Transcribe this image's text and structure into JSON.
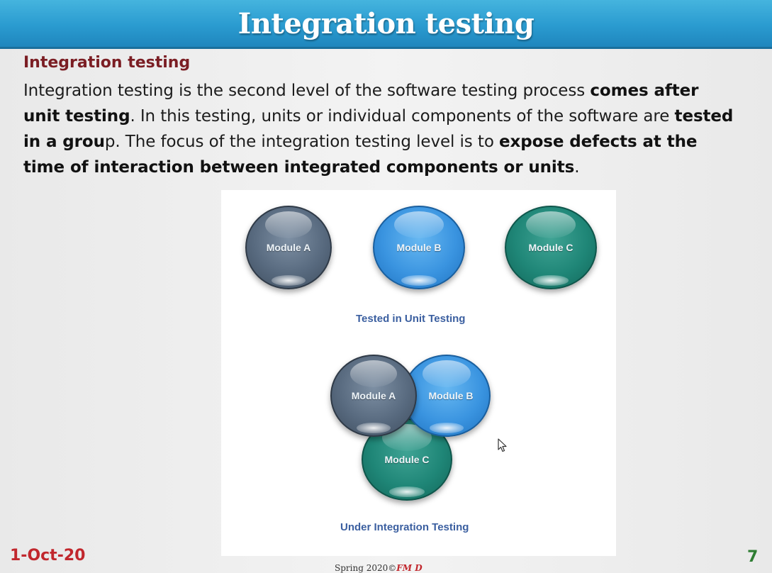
{
  "slide": {
    "title": "Integration testing",
    "subheading": "Integration testing",
    "body": {
      "s1": "Integration testing is the second level of the software testing process ",
      "s1_bold": "comes after unit testing",
      "s2": ". In this testing, units or individual components of the software are ",
      "s2_bold": "tested in a grou",
      "s3": "p. The focus of the integration testing level is to ",
      "s3_bold": "expose defects at the time of interaction between integrated components or units",
      "s4": "."
    },
    "figure": {
      "unit": {
        "module_a": "Module A",
        "module_b": "Module B",
        "module_c": "Module C",
        "caption": "Tested in Unit Testing"
      },
      "integration": {
        "module_a": "Module A",
        "module_b": "Module B",
        "module_c": "Module C",
        "caption": "Under Integration Testing"
      }
    },
    "footer": {
      "date": "1-Oct-20",
      "center_text": "Spring  2020©",
      "center_brand": "FM D",
      "page_number": "7"
    }
  },
  "colors": {
    "title_bar": "#2a9bd0",
    "subheading": "#7b1e24",
    "footer_date": "#c1272d",
    "page_number": "#2e7d32",
    "module_a": "#586a7f",
    "module_b": "#3a94e0",
    "module_c": "#1f8677"
  },
  "icons": {
    "cursor": "mouse-pointer-icon"
  }
}
